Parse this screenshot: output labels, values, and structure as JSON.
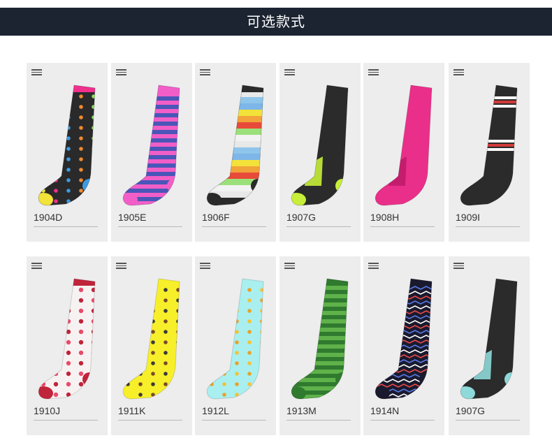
{
  "header": {
    "title": "可选款式"
  },
  "products": [
    {
      "code": "1904D",
      "style": "hearts",
      "base": "#2a2a2a",
      "cuff": "#f0308c",
      "toe": "#f2e23a",
      "heel": "#3d9be0",
      "colors": [
        "#f2e23a",
        "#f0308c",
        "#3d9be0",
        "#f08a30",
        "#8be05a"
      ]
    },
    {
      "code": "1905E",
      "style": "stripes",
      "base": "#4a56b8",
      "cuff": "#f25ec7",
      "toe": "#f25ec7",
      "heel": "#f25ec7",
      "colors": [
        "#f25ec7",
        "#4a56b8"
      ]
    },
    {
      "code": "1906F",
      "style": "rainbow",
      "base": "#2a2a2a",
      "cuff": "#2a2a2a",
      "toe": "#2a2a2a",
      "heel": "#2a2a2a",
      "colors": [
        "#e8e8e8",
        "#8fc5ea",
        "#7db6e8",
        "#f2e23a",
        "#f2a33a",
        "#e84a3a",
        "#9be07a",
        "#f2f2f2"
      ]
    },
    {
      "code": "1907G",
      "style": "solid",
      "base": "#2b2b2b",
      "cuff": "#2b2b2b",
      "toe": "#c7ef3a",
      "heel": "#c7ef3a",
      "colors": [
        "#c7ef3a"
      ]
    },
    {
      "code": "1908H",
      "style": "solid",
      "base": "#ea2f8a",
      "cuff": "#ea2f8a",
      "toe": "#ea2f8a",
      "heel": "#ea2f8a",
      "colors": [
        "#c01c6a"
      ]
    },
    {
      "code": "1909I",
      "style": "usa",
      "base": "#2b2b2b",
      "cuff": "#2b2b2b",
      "toe": "#2b2b2b",
      "heel": "#2b2b2b",
      "colors": [
        "#ffffff",
        "#d23a3a"
      ]
    },
    {
      "code": "1910J",
      "style": "lips",
      "base": "#f7f2f2",
      "cuff": "#c0243a",
      "toe": "#c0243a",
      "heel": "#c0243a",
      "colors": [
        "#c0243a",
        "#e84a6a"
      ]
    },
    {
      "code": "1911K",
      "style": "dots",
      "base": "#f7ef2a",
      "cuff": "#f7ef2a",
      "toe": "#f7ef2a",
      "heel": "#f7ef2a",
      "colors": [
        "#7a4a2a",
        "#3a3a3a"
      ]
    },
    {
      "code": "1912L",
      "style": "dots",
      "base": "#a9efef",
      "cuff": "#a9efef",
      "toe": "#a9efef",
      "heel": "#a9efef",
      "colors": [
        "#f2c23a",
        "#e8a22a"
      ]
    },
    {
      "code": "1913M",
      "style": "stripes",
      "base": "#2f7a2f",
      "cuff": "#2f7a2f",
      "toe": "#2f7a2f",
      "heel": "#2f7a2f",
      "colors": [
        "#5fb24a",
        "#2f7a2f"
      ]
    },
    {
      "code": "1914N",
      "style": "zigzag",
      "base": "#1a1a2e",
      "cuff": "#1a1a2e",
      "toe": "#1a1a2e",
      "heel": "#1a1a2e",
      "colors": [
        "#e84a4a",
        "#5a7ae8",
        "#ffffff"
      ]
    },
    {
      "code": "1907G",
      "style": "solid",
      "base": "#2b2b2b",
      "cuff": "#2b2b2b",
      "toe": "#8ed9d9",
      "heel": "#8ed9d9",
      "colors": [
        "#8ed9d9"
      ]
    }
  ]
}
